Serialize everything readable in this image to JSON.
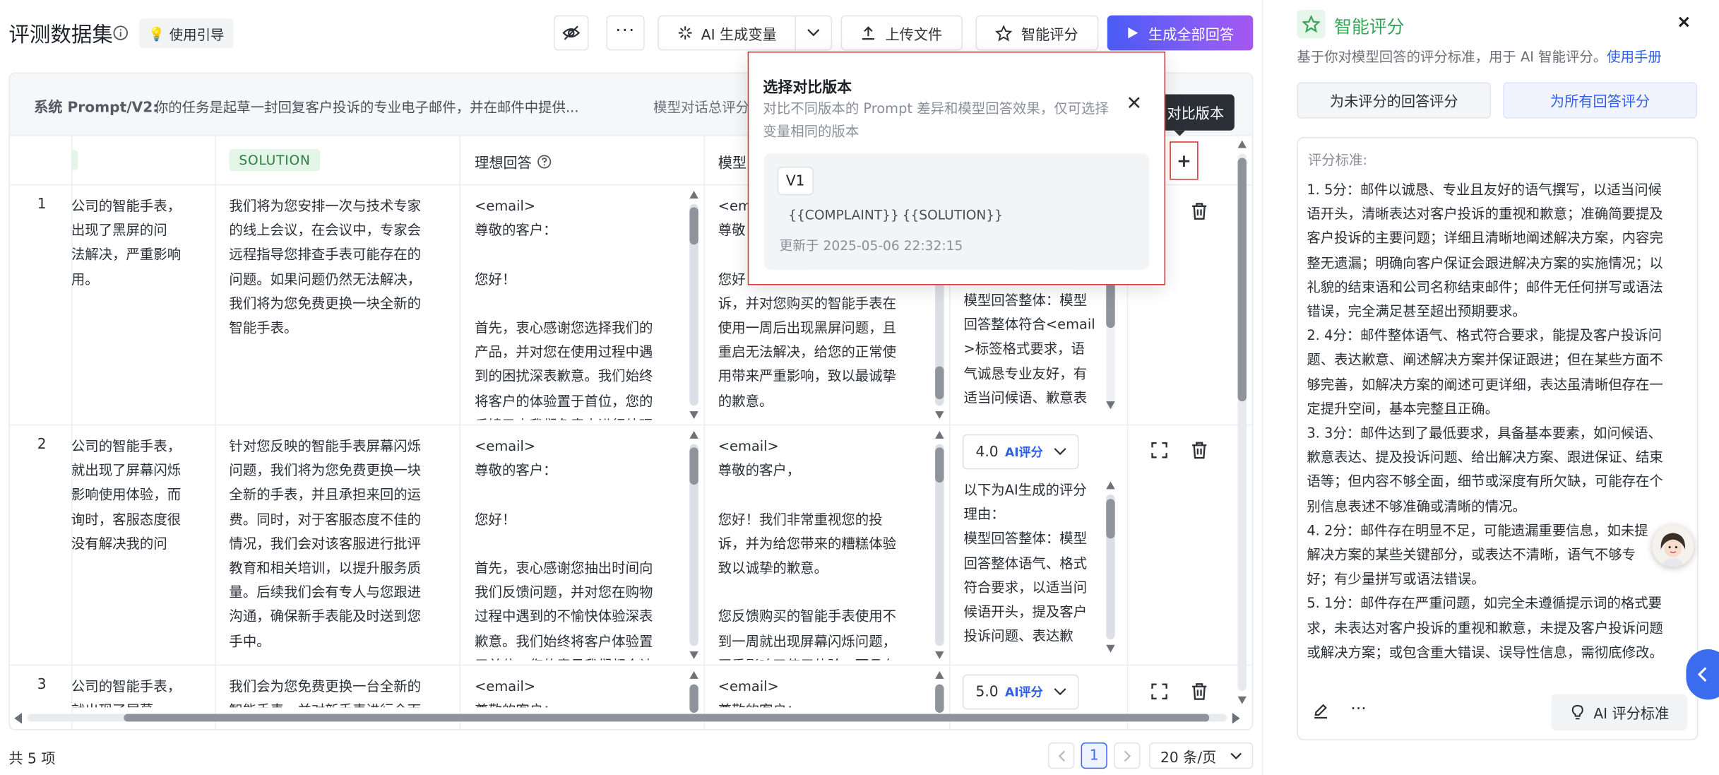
{
  "header": {
    "title": "评测数据集",
    "guide_label": "使用引导",
    "ai_gen_label": "AI 生成变量",
    "upload_label": "上传文件",
    "smart_score_label": "智能评分",
    "generate_all_label": "生成全部回答"
  },
  "system_prompt": {
    "label": "系统 Prompt/V2:",
    "text": "你的任务是起草一封回复客户投诉的专业电子邮件，并在邮件中提供...",
    "summary_label": "模型对话总评分"
  },
  "columns": {
    "solution": "SOLUTION",
    "ideal": "理想回答",
    "model": "模型"
  },
  "tooltip": "对比版本",
  "rows": [
    {
      "num": "1",
      "complaint": "公司的智能手表，\n出现了黑屏的问\n法解决，严重影响\n用。",
      "solution": "我们将为您安排一次与技术专家\n的线上会议，在会议中，专家会\n远程指导您排查手表可能存在的\n问题。如果问题仍然无法解决，\n我们将为您免费更换一块全新的\n智能手表。",
      "ideal": "<email>\n尊敬的客户：\n\n您好！\n\n首先，衷心感谢您选择我们的\n产品，并对您在使用过程中遇\n到的困扰深表歉意。我们始终\n将客户的体验置于首位，您的\n反馈已由我们负责人进行处理",
      "model": "<em\n尊敬\n\n您好\n诉，并对您购买的智能手表在\n使用一周后出现黑屏问题，且\n重启无法解决，给您的正常使\n用带来严重影响，致以最诚挚\n的歉意。",
      "reason": "模型回答整体：模型\n回答整体符合<email\n>标签格式要求，语\n气诚恳专业友好，有\n适当问候语、歉意表"
    },
    {
      "num": "2",
      "complaint": "公司的智能手表，\n就出现了屏幕闪烁\n影响使用体验，而\n询时，客服态度很\n没有解决我的问",
      "solution": "针对您反映的智能手表屏幕闪烁\n问题，我们将为您免费更换一块\n全新的手表，并且承担来回的运\n费。同时，对于客服态度不佳的\n情况，我们会对该客服进行批评\n教育和相关培训，以提升服务质\n量。后续我们会有专人与您跟进\n沟通，确保新手表能及时送到您\n手中。",
      "ideal": "<email>\n尊敬的客户：\n\n您好！\n\n首先，衷心感谢您抽出时间向\n我们反馈问题，并对您在购物\n过程中遇到的不愉快体验深表\n歉意。我们始终将客户体验置\n于首位，您的意见我们都会认",
      "model": "<email>\n尊敬的客户，\n\n您好！我们非常重视您的投\n诉，并为给您带来的糟糕体验\n致以诚挚的歉意。\n\n您反馈购买的智能手表使用不\n到一周就出现屏幕闪烁问题，\n严重影响了使用体验，而且在",
      "score": "4.0",
      "reason": "以下为AI生成的评分\n理由：\n模型回答整体：模型\n回答整体语气、格式\n符合要求，以适当问\n候语开头，提及客户\n投诉问题、表达歉"
    },
    {
      "num": "3",
      "complaint": "公司的智能手表，\n就出现了屏幕",
      "solution": "我们会为您免费更换一台全新的\n智能手表，并对新手表进行全面",
      "ideal": "<email>\n尊敬的客户：",
      "model": "<email>\n尊敬的客户：",
      "score": "5.0"
    }
  ],
  "score_badge": "AI评分",
  "popover": {
    "title": "选择对比版本",
    "desc": "对比不同版本的 Prompt 差异和模型回答效果，仅可选择变量相同的版本",
    "version": "V1",
    "var1": "{{COMPLAINT}}",
    "var2": "{{SOLUTION}}",
    "updated": "更新于 2025-05-06 22:32:15"
  },
  "footer": {
    "total": "共 5 项",
    "page": "1",
    "page_size": "20 条/页"
  },
  "panel": {
    "title": "智能评分",
    "subtitle": "基于你对模型回答的评分标准，用于 AI 智能评分。",
    "manual_link": "使用手册",
    "btn_unscored": "为未评分的回答评分",
    "btn_all": "为所有回答评分",
    "criteria_label": "评分标准:",
    "criteria_text": "1. 5分：邮件以诚恳、专业且友好的语气撰写，以适当问候\n语开头，清晰表达对客户投诉的重视和歉意；准确简要提及\n客户投诉的主要问题；详细且清晰地阐述解决方案，内容完\n整无遗漏；明确向客户保证会跟进解决方案的实施情况；以\n礼貌的结束语和公司名称结束邮件；邮件无任何拼写或语法\n错误，完全满足甚至超出预期要求。\n2. 4分：邮件整体语气、格式符合要求，能提及客户投诉问\n题、表达歉意、阐述解决方案并保证跟进；但在某些方面不\n够完善，如解决方案的阐述可更详细，表达虽清晰但存在一\n定提升空间，基本完整且正确。\n3. 3分：邮件达到了最低要求，具备基本要素，如问候语、\n歉意表达、提及投诉问题、给出解决方案、跟进保证、结束\n语等；但内容不够全面，细节或深度有所欠缺，可能存在个\n别信息表述不够准确或清晰的情况。\n4. 2分：邮件存在明显不足，可能遗漏重要信息，如未提\n解决方案的某些关键部分，或表达不清晰，语气不够专\n好；有少量拼写或语法错误。\n5. 1分：邮件存在严重问题，如完全未遵循提示词的格式要\n求，未表达对客户投诉的重视和歉意，未提及客户投诉问题\n或解决方案；或包含重大错误、误导性信息，需彻底修改。",
    "ai_criteria_label": "AI 评分标准"
  },
  "colors": {
    "primary": "#4a5cf6",
    "gradient_end": "#a557f0",
    "link": "#2f5fe8",
    "highlight_red": "#e0303a",
    "panel_green": "#35a457"
  }
}
